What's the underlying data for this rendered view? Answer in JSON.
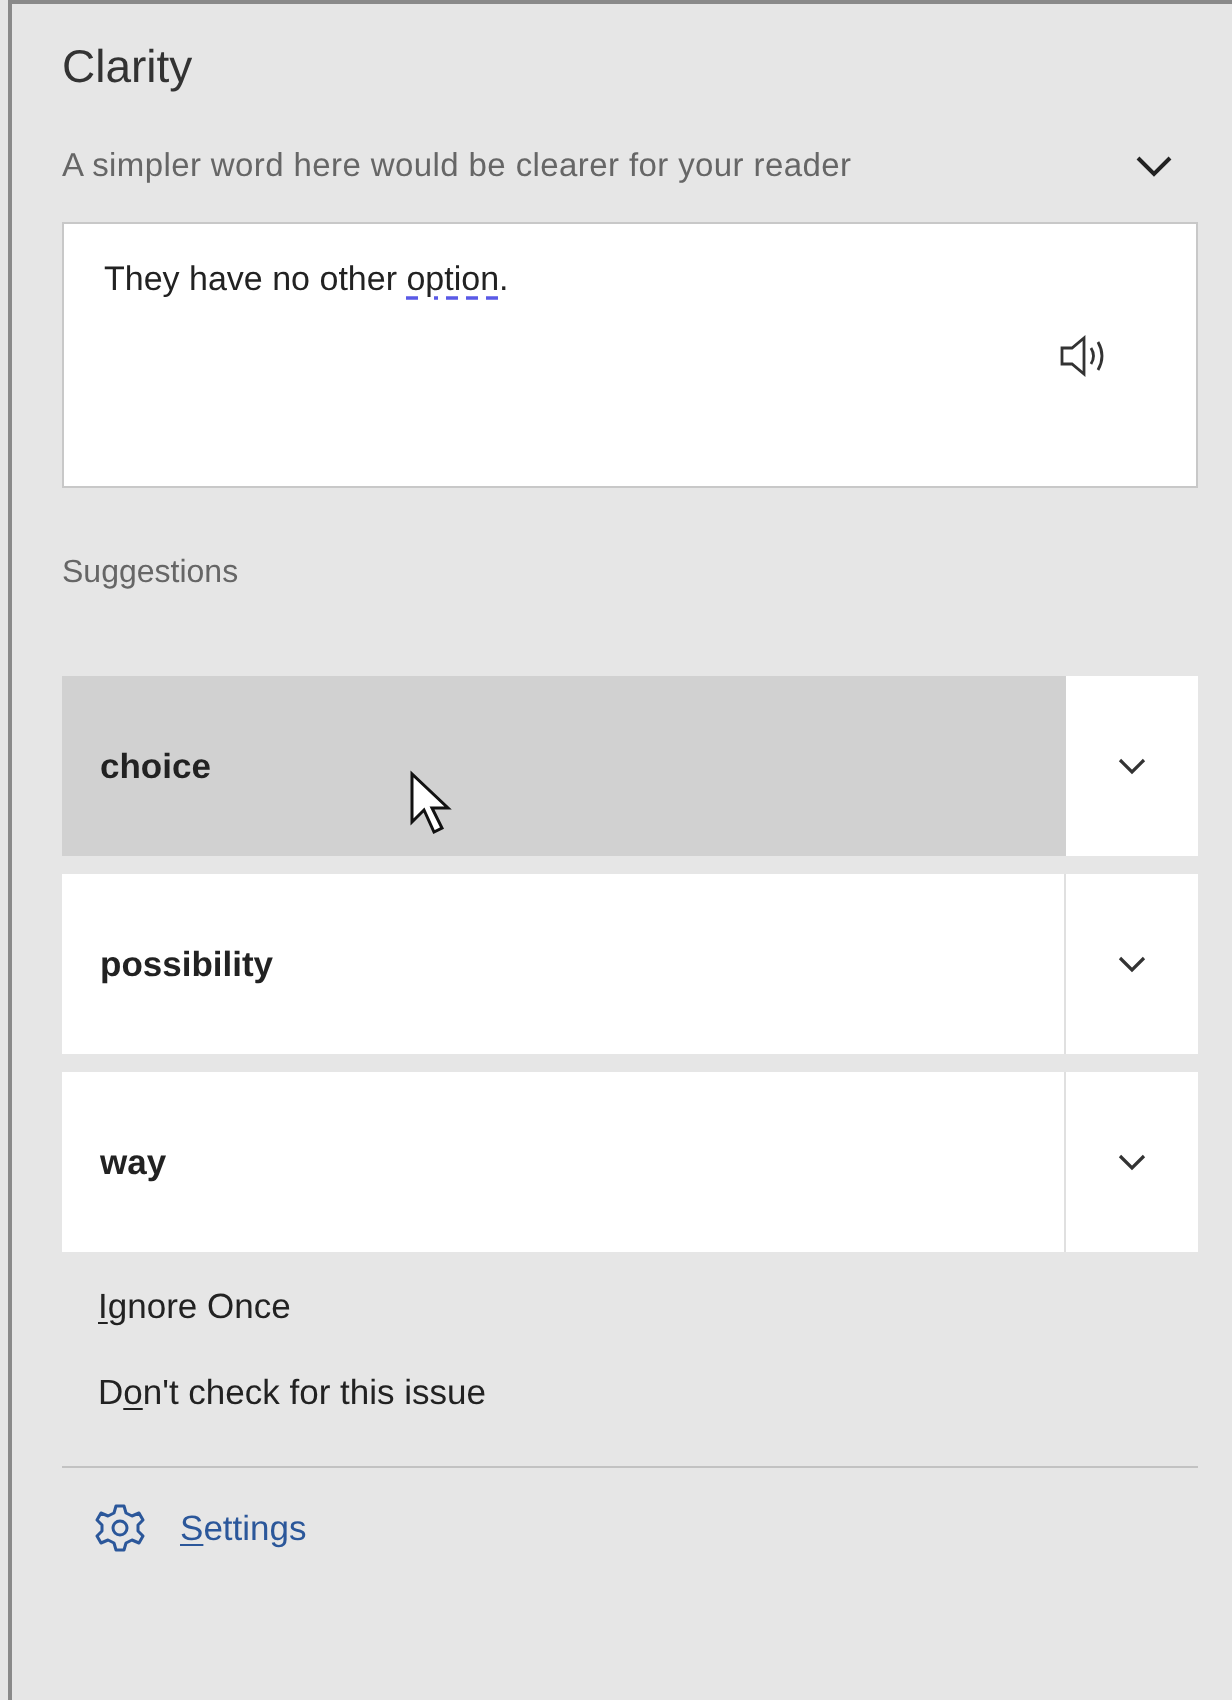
{
  "pane": {
    "title": "Clarity",
    "issue": "A simpler word here would be clearer for your reader",
    "issue_expanded": false
  },
  "sentence": {
    "before": "They have no other ",
    "flagged": "option",
    "after": "."
  },
  "suggestions_label": "Suggestions",
  "suggestions": [
    {
      "word": "choice",
      "selected": true
    },
    {
      "word": "possibility",
      "selected": false
    },
    {
      "word": "way",
      "selected": false
    }
  ],
  "actions": [
    {
      "key": "I",
      "after": "gnore Once"
    },
    {
      "before": "D",
      "key": "o",
      "after": "n't check for this issue"
    }
  ],
  "settings": {
    "key": "S",
    "after": "ettings"
  }
}
